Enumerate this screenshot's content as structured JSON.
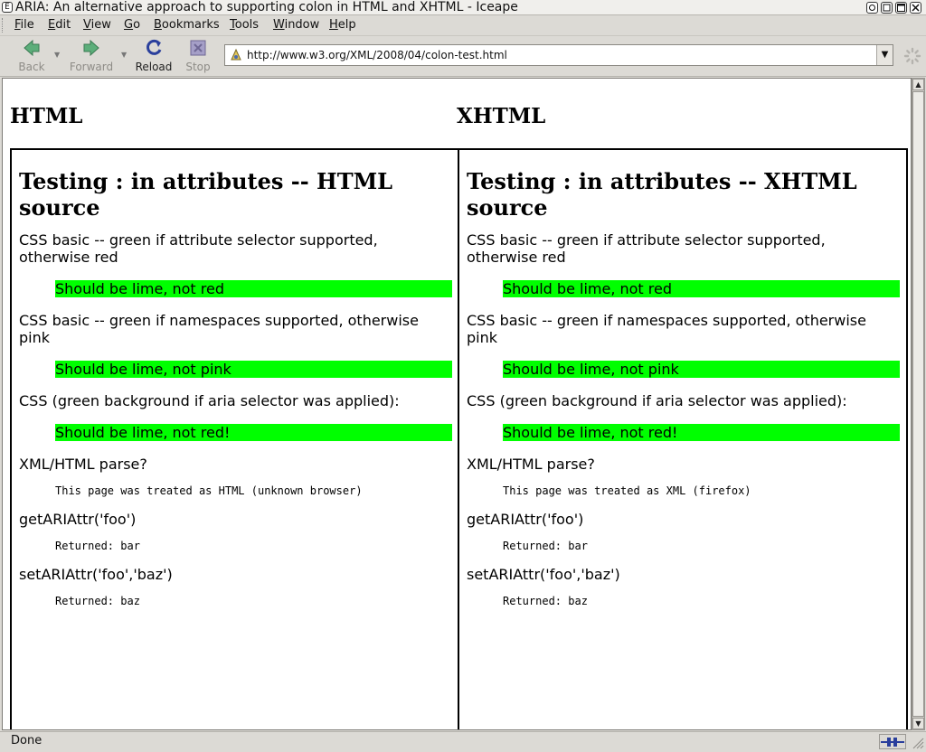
{
  "window": {
    "title": "ARIA: An alternative approach to supporting colon in HTML and XHTML - Iceape",
    "system_icon": "iceape-window-icon",
    "controls": [
      "minimize-button",
      "shade-button",
      "maximize-button",
      "close-button"
    ]
  },
  "menubar": {
    "items": [
      {
        "label": "File",
        "accel": "F"
      },
      {
        "label": "Edit",
        "accel": "E"
      },
      {
        "label": "View",
        "accel": "V"
      },
      {
        "label": "Go",
        "accel": "G"
      },
      {
        "label": "Bookmarks",
        "accel": "B"
      },
      {
        "label": "Tools",
        "accel": "T"
      },
      {
        "label": "Window",
        "accel": "W"
      },
      {
        "label": "Help",
        "accel": "H"
      }
    ]
  },
  "toolbar": {
    "back": {
      "label": "Back",
      "icon": "back-arrow-icon",
      "enabled": false
    },
    "forward": {
      "label": "Forward",
      "icon": "forward-arrow-icon",
      "enabled": false
    },
    "reload": {
      "label": "Reload",
      "icon": "reload-icon",
      "enabled": true
    },
    "stop": {
      "label": "Stop",
      "icon": "stop-icon",
      "enabled": false
    },
    "url": "http://www.w3.org/XML/2008/04/colon-test.html"
  },
  "page": {
    "html_heading": "HTML",
    "xhtml_heading": "XHTML",
    "panes": [
      {
        "title": "Testing : in attributes -- HTML source",
        "q1": "CSS basic -- green if attribute selector supported, otherwise red",
        "r1": "Should be lime, not red",
        "q2": "CSS basic -- green if namespaces supported, otherwise pink",
        "r2": "Should be lime, not pink",
        "q3": "CSS (green background if aria selector was applied):",
        "r3": "Should be lime, not red!",
        "q4": "XML/HTML parse?",
        "r4": "This page was treated as HTML (unknown browser)",
        "q5": "getARIAttr('foo')",
        "r5": "Returned: bar",
        "q6": "setARIAttr('foo','baz')",
        "r6": "Returned: baz"
      },
      {
        "title": "Testing : in attributes -- XHTML source",
        "q1": "CSS basic -- green if attribute selector supported, otherwise red",
        "r1": "Should be lime, not red",
        "q2": "CSS basic -- green if namespaces supported, otherwise pink",
        "r2": "Should be lime, not pink",
        "q3": "CSS (green background if aria selector was applied):",
        "r3": "Should be lime, not red!",
        "q4": "XML/HTML parse?",
        "r4": "This page was treated as XML (firefox)",
        "q5": "getARIAttr('foo')",
        "r5": "Returned: bar",
        "q6": "setARIAttr('foo','baz')",
        "r6": "Returned: baz"
      }
    ],
    "lime_color": "#00ff00"
  },
  "statusbar": {
    "text": "Done"
  }
}
